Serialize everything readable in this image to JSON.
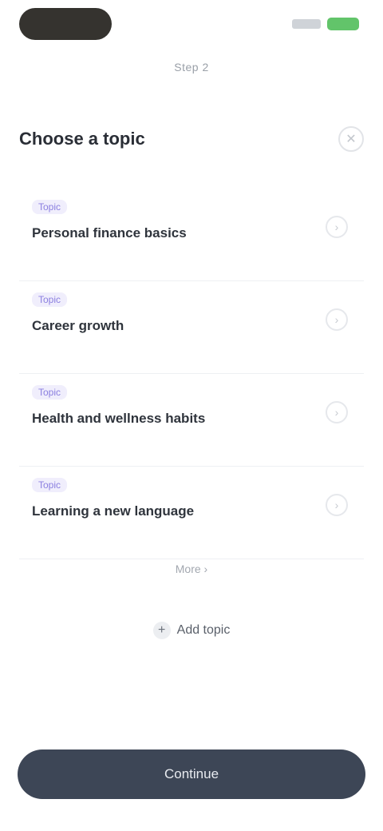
{
  "status_bar": {
    "signal_icon": "signal-icon",
    "battery_icon": "battery-icon",
    "battery_color": "#62c46a"
  },
  "page": {
    "subtitle": "Step 2",
    "section_title": "Choose a topic",
    "header_icon": "close-icon"
  },
  "items": [
    {
      "tag": "Topic",
      "title": "Personal finance basics",
      "icon": "chevron-right-icon"
    },
    {
      "tag": "Topic",
      "title": "Career growth",
      "icon": "chevron-right-icon"
    },
    {
      "tag": "Topic",
      "title": "Health and wellness habits",
      "icon": "chevron-right-icon"
    },
    {
      "tag": "Topic",
      "title": "Learning a new language",
      "icon": "chevron-right-icon"
    }
  ],
  "more": {
    "label": "More ›"
  },
  "secondary": {
    "label": "Add topic",
    "icon": "plus-icon"
  },
  "primary": {
    "label": "Continue",
    "color": "#3d4656"
  }
}
